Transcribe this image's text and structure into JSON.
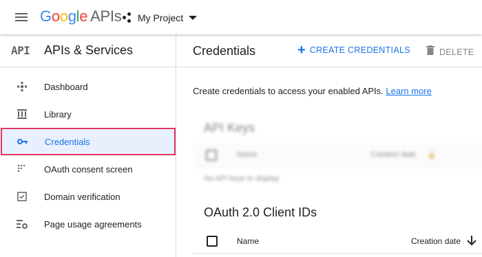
{
  "topbar": {
    "logo_letters": [
      "G",
      "o",
      "o",
      "g",
      "l",
      "e"
    ],
    "logo_suffix": "APIs",
    "project_name": "My Project",
    "icons": {
      "menu": "hamburger-icon",
      "project": "project-dots-icon",
      "dropdown": "caret-down-icon"
    }
  },
  "sidebar": {
    "glyph": "API",
    "title": "APIs & Services",
    "items": [
      {
        "label": "Dashboard",
        "icon": "dashboard-icon",
        "active": false
      },
      {
        "label": "Library",
        "icon": "library-icon",
        "active": false
      },
      {
        "label": "Credentials",
        "icon": "key-icon",
        "active": true
      },
      {
        "label": "OAuth consent screen",
        "icon": "consent-icon",
        "active": false
      },
      {
        "label": "Domain verification",
        "icon": "checkbox-icon",
        "active": false
      },
      {
        "label": "Page usage agreements",
        "icon": "settings-list-icon",
        "active": false
      }
    ]
  },
  "main": {
    "title": "Credentials",
    "create_label": "CREATE CREDENTIALS",
    "delete_label": "DELETE",
    "info_text": "Create credentials to access your enabled APIs.",
    "learn_more": "Learn more",
    "api_keys": {
      "title": "API Keys",
      "col_name": "Name",
      "col_date": "Creation date",
      "empty": "No API keys to display"
    },
    "oauth": {
      "title": "OAuth 2.0 Client IDs",
      "col_name": "Name",
      "col_date": "Creation date",
      "sort_icon": "arrow-down-icon"
    }
  },
  "colors": {
    "accent": "#1a73e8",
    "active_bg": "#e8f0fe",
    "highlight_outline": "#e53563"
  }
}
